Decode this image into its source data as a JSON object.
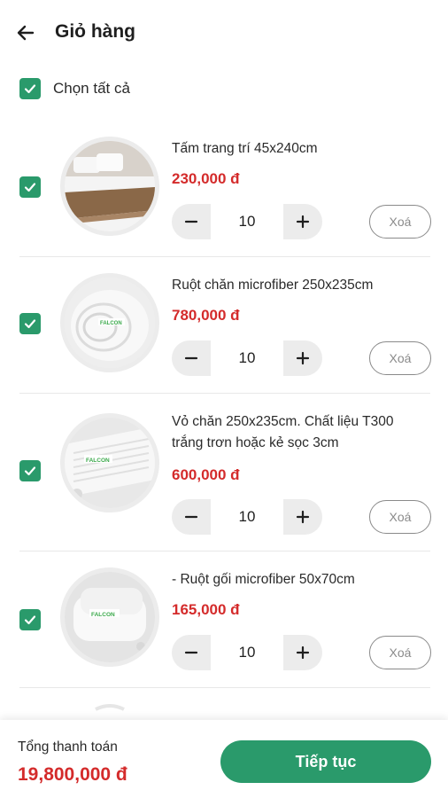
{
  "header": {
    "title": "Giỏ hàng",
    "back_icon": "arrow-left-icon"
  },
  "select_all": {
    "label": "Chọn tất cả",
    "checked": true
  },
  "colors": {
    "accent": "#2a9a6b",
    "price": "#d42b2b",
    "stepper_bg": "#ececec"
  },
  "items": [
    {
      "name": "Tấm trang trí 45x240cm",
      "price": "230,000 đ",
      "quantity": "10",
      "delete_label": "Xoá",
      "checked": true,
      "image": "bed-runner-photo"
    },
    {
      "name": "Ruột chăn microfiber 250x235cm",
      "price": "780,000 đ",
      "quantity": "10",
      "delete_label": "Xoá",
      "checked": true,
      "image": "duvet-roll-photo"
    },
    {
      "name": "Vỏ chăn 250x235cm. Chất liệu T300 trắng trơn hoặc kẻ sọc 3cm",
      "price": "600,000 đ",
      "quantity": "10",
      "delete_label": "Xoá",
      "checked": true,
      "image": "duvet-cover-photo"
    },
    {
      "name": "- Ruột gối microfiber 50x70cm",
      "price": "165,000 đ",
      "quantity": "10",
      "delete_label": "Xoá",
      "checked": true,
      "image": "pillow-photo"
    }
  ],
  "footer": {
    "total_label": "Tổng thanh toán",
    "total_value": "19,800,000 đ",
    "continue_label": "Tiếp tục"
  }
}
